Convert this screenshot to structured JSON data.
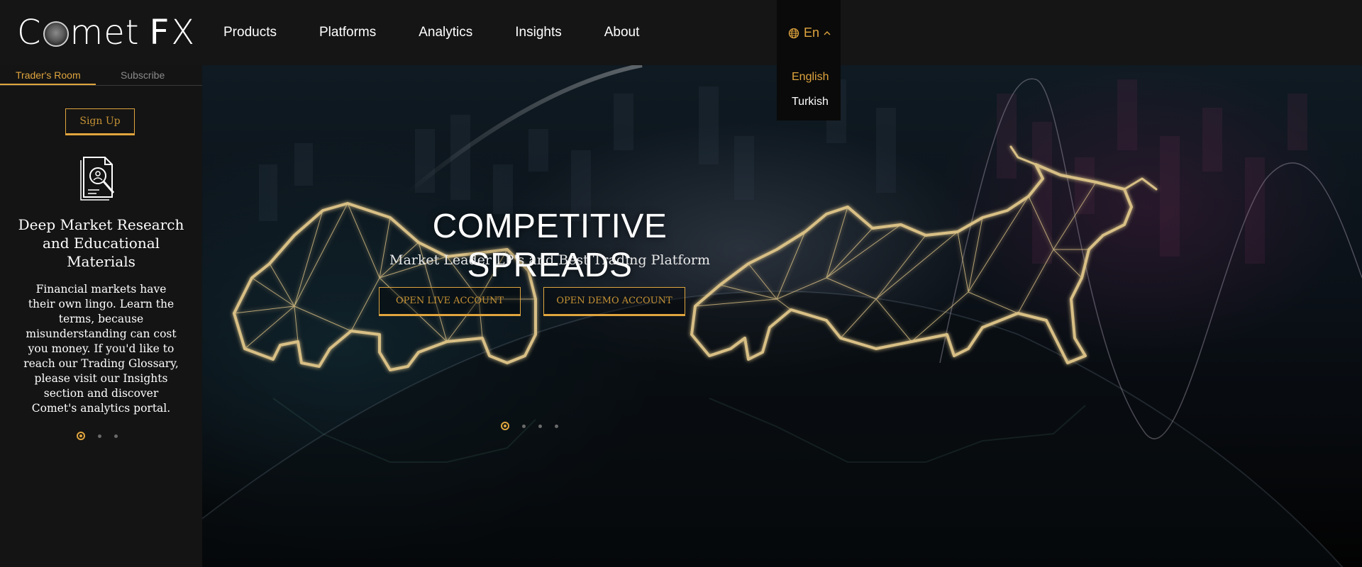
{
  "header": {
    "logo": {
      "text_left": "C",
      "text_right": "met",
      "text_fx_f": "F",
      "text_fx_x": "X"
    },
    "nav": [
      {
        "label": "Products"
      },
      {
        "label": "Platforms"
      },
      {
        "label": "Analytics"
      },
      {
        "label": "Insights"
      },
      {
        "label": "About"
      }
    ],
    "language": {
      "current": "En",
      "options": [
        "English",
        "Turkish"
      ],
      "selected": "English"
    }
  },
  "sidebar": {
    "tabs": [
      {
        "label": "Trader's Room",
        "active": true
      },
      {
        "label": "Subscribe",
        "active": false
      }
    ],
    "signup_label": "Sign Up",
    "icon": "document-search-icon",
    "title": "Deep Market Research and Educational Materials",
    "text": "Financial markets have their own lingo. Learn the terms, because misunderstanding can cost you money. If you'd like to reach our Trading Glossary, please visit our Insights section and discover Comet's analytics portal.",
    "slider": {
      "count": 3,
      "active_index": 0
    }
  },
  "hero": {
    "title": "COMPETITIVE SPREADS",
    "subtitle": "Market Leader LP's and Best Trading Platform",
    "buttons": {
      "live": "OPEN LIVE ACCOUNT",
      "demo": "OPEN DEMO ACCOUNT"
    },
    "slider": {
      "count": 4,
      "active_index": 0
    }
  },
  "colors": {
    "accent": "#e0a53e",
    "background": "#111111",
    "header": "#151515",
    "sidebar": "#141414"
  }
}
